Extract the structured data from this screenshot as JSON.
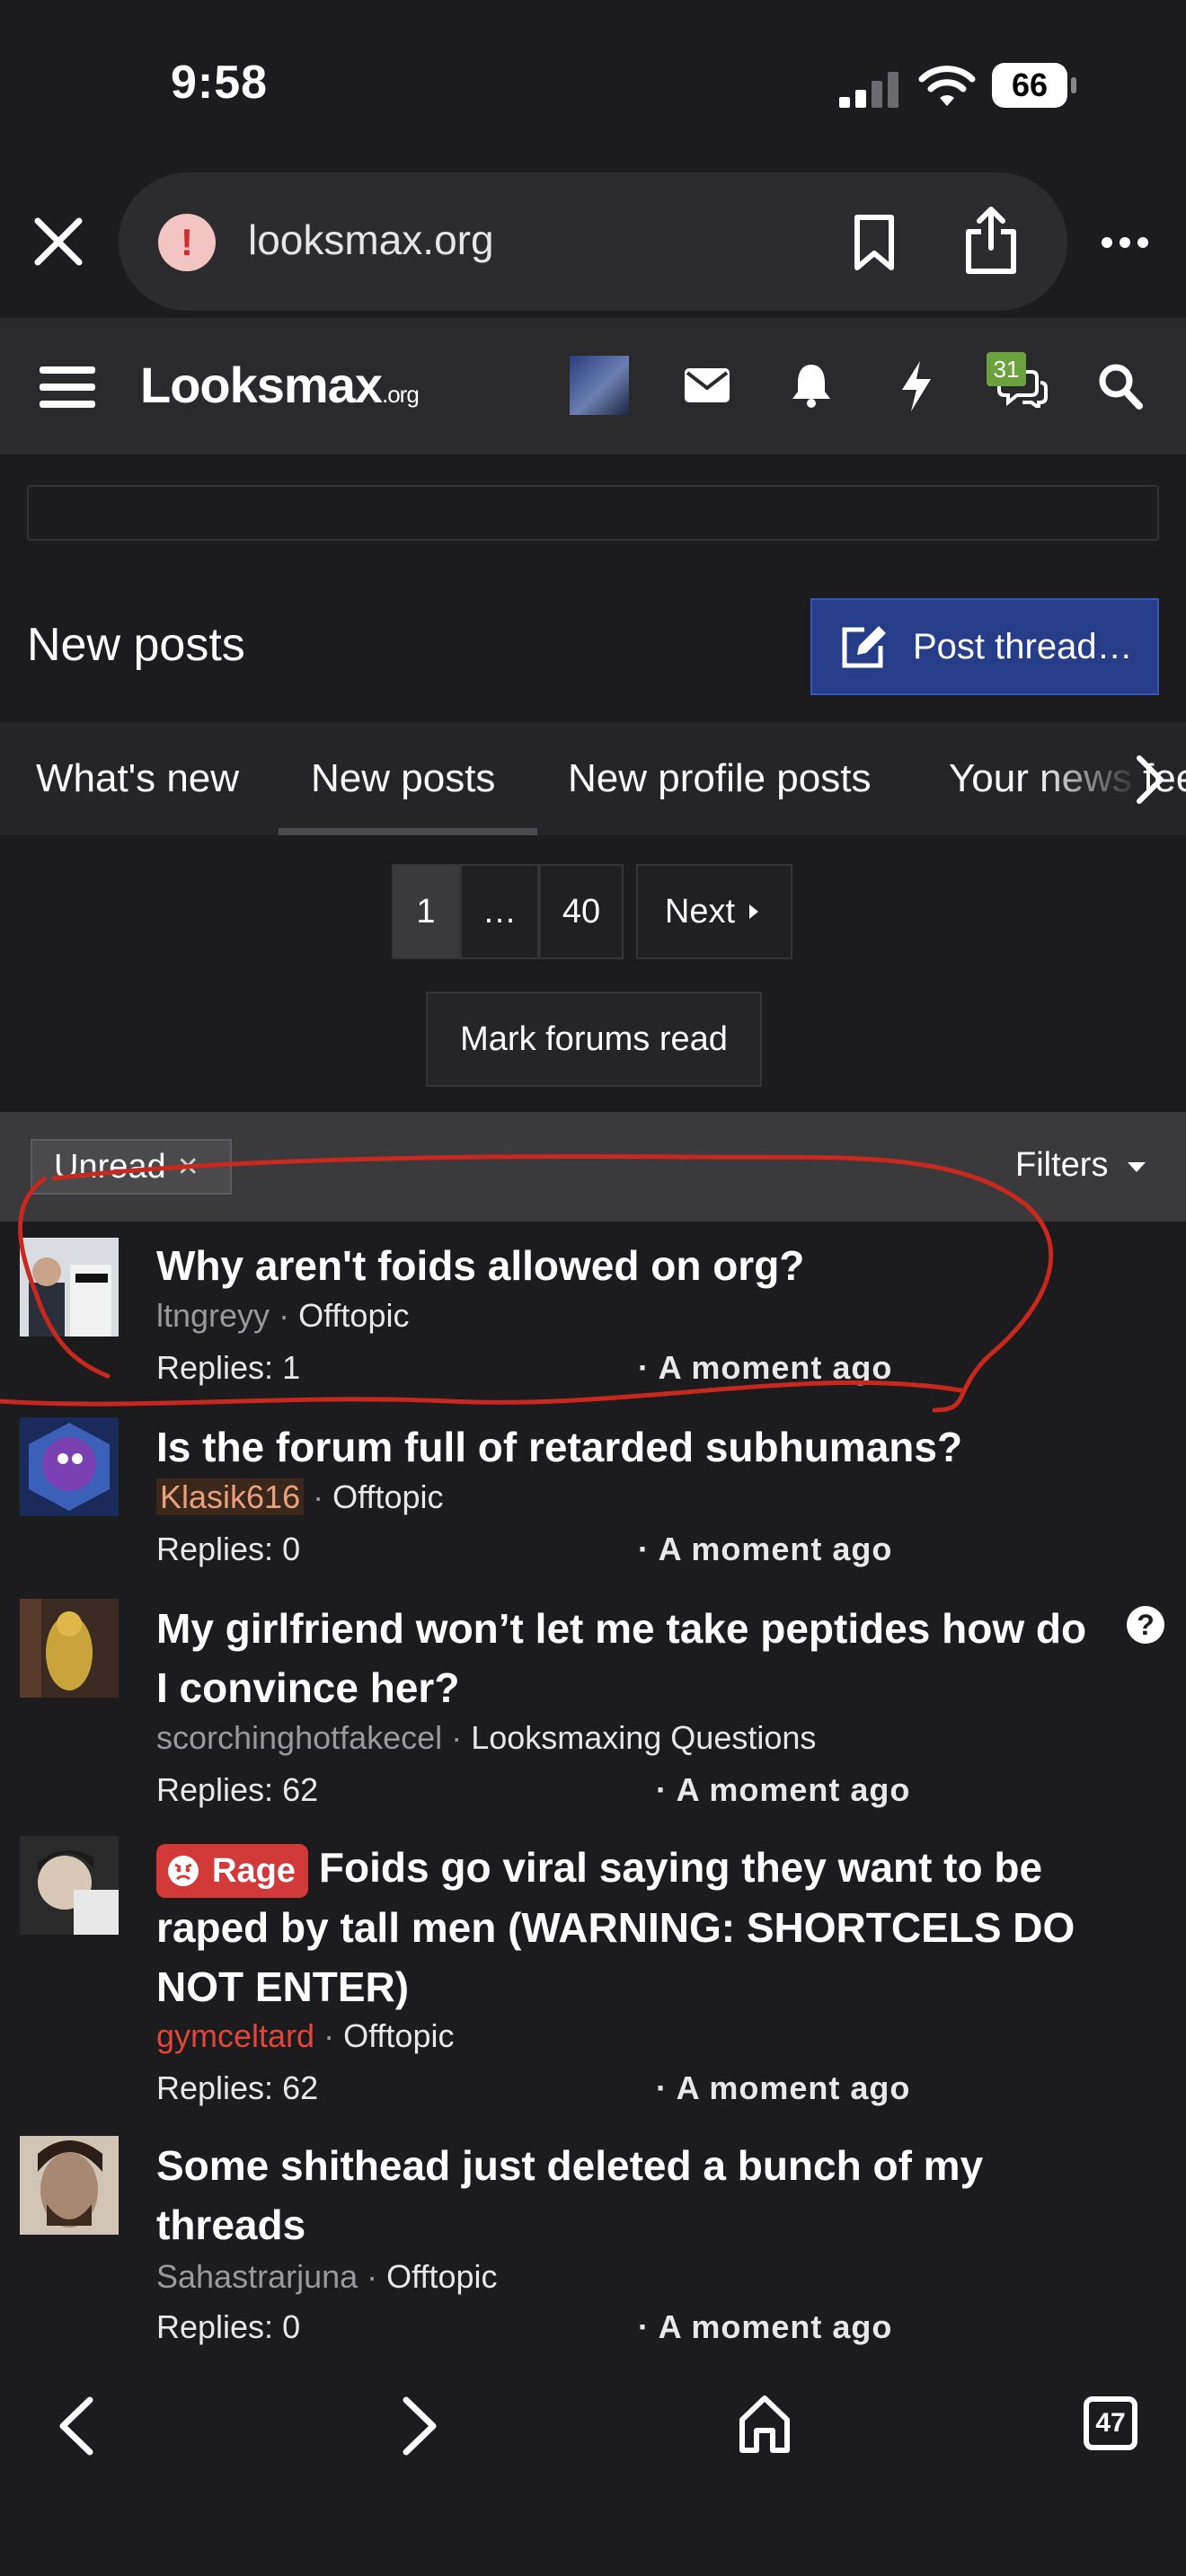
{
  "status_bar": {
    "time": "9:58",
    "battery": "66"
  },
  "browser": {
    "url": "looksmax.org",
    "tab_count": "47"
  },
  "site": {
    "logo_main": "Looksmax",
    "logo_suffix": ".org",
    "chat_badge": "31",
    "colors": {
      "post_button": "#263d8a",
      "badge": "#6aa33d",
      "rage": "#d23a3a",
      "annotation": "#c8281e"
    }
  },
  "page": {
    "title": "New posts",
    "post_thread_label": "Post thread…",
    "tabs": [
      "What's new",
      "New posts",
      "New profile posts",
      "Your news feed"
    ],
    "active_tab": "New posts",
    "pagination": {
      "current": "1",
      "ellipsis": "…",
      "last": "40",
      "next": "Next"
    },
    "mark_read": "Mark forums read",
    "filter_chip": "Unread",
    "filter_chip_remove": "✕",
    "filters_label": "Filters"
  },
  "threads": [
    {
      "title": "Why aren't foids allowed on org?",
      "author": "ltngreyy",
      "forum": "Offtopic",
      "replies": "Replies: 1",
      "time": "· A moment ago"
    },
    {
      "title": "Is the forum full of retarded subhumans?",
      "author": "Klasik616",
      "forum": "Offtopic",
      "replies": "Replies: 0",
      "time": "· A moment ago"
    },
    {
      "title": "My girlfriend won’t let me take peptides how do I convince her?",
      "author": "scorchinghotfakecel",
      "forum": "Looksmaxing Questions",
      "replies": "Replies: 62",
      "time": "· A moment ago"
    },
    {
      "prefix": "Rage",
      "title": "Foids go viral saying they want to be raped by tall men (WARNING: SHORTCELS DO NOT ENTER)",
      "author": "gymceltard",
      "forum": "Offtopic",
      "replies": "Replies: 62",
      "time": "· A moment ago"
    },
    {
      "title": "Some shithead just deleted a bunch of my threads",
      "author": "Sahastrarjuna",
      "forum": "Offtopic",
      "replies": "Replies: 0",
      "time": "· A moment ago"
    }
  ],
  "meta_separator": " · "
}
